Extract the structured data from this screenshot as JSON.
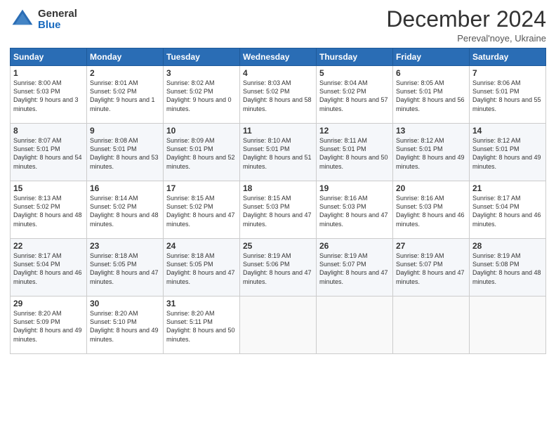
{
  "logo": {
    "general": "General",
    "blue": "Blue"
  },
  "header": {
    "month": "December 2024",
    "location": "Pereval'noye, Ukraine"
  },
  "weekdays": [
    "Sunday",
    "Monday",
    "Tuesday",
    "Wednesday",
    "Thursday",
    "Friday",
    "Saturday"
  ],
  "weeks": [
    [
      {
        "day": "1",
        "sunrise": "8:00 AM",
        "sunset": "5:03 PM",
        "daylight": "9 hours and 3 minutes."
      },
      {
        "day": "2",
        "sunrise": "8:01 AM",
        "sunset": "5:02 PM",
        "daylight": "9 hours and 1 minute."
      },
      {
        "day": "3",
        "sunrise": "8:02 AM",
        "sunset": "5:02 PM",
        "daylight": "9 hours and 0 minutes."
      },
      {
        "day": "4",
        "sunrise": "8:03 AM",
        "sunset": "5:02 PM",
        "daylight": "8 hours and 58 minutes."
      },
      {
        "day": "5",
        "sunrise": "8:04 AM",
        "sunset": "5:02 PM",
        "daylight": "8 hours and 57 minutes."
      },
      {
        "day": "6",
        "sunrise": "8:05 AM",
        "sunset": "5:01 PM",
        "daylight": "8 hours and 56 minutes."
      },
      {
        "day": "7",
        "sunrise": "8:06 AM",
        "sunset": "5:01 PM",
        "daylight": "8 hours and 55 minutes."
      }
    ],
    [
      {
        "day": "8",
        "sunrise": "8:07 AM",
        "sunset": "5:01 PM",
        "daylight": "8 hours and 54 minutes."
      },
      {
        "day": "9",
        "sunrise": "8:08 AM",
        "sunset": "5:01 PM",
        "daylight": "8 hours and 53 minutes."
      },
      {
        "day": "10",
        "sunrise": "8:09 AM",
        "sunset": "5:01 PM",
        "daylight": "8 hours and 52 minutes."
      },
      {
        "day": "11",
        "sunrise": "8:10 AM",
        "sunset": "5:01 PM",
        "daylight": "8 hours and 51 minutes."
      },
      {
        "day": "12",
        "sunrise": "8:11 AM",
        "sunset": "5:01 PM",
        "daylight": "8 hours and 50 minutes."
      },
      {
        "day": "13",
        "sunrise": "8:12 AM",
        "sunset": "5:01 PM",
        "daylight": "8 hours and 49 minutes."
      },
      {
        "day": "14",
        "sunrise": "8:12 AM",
        "sunset": "5:01 PM",
        "daylight": "8 hours and 49 minutes."
      }
    ],
    [
      {
        "day": "15",
        "sunrise": "8:13 AM",
        "sunset": "5:02 PM",
        "daylight": "8 hours and 48 minutes."
      },
      {
        "day": "16",
        "sunrise": "8:14 AM",
        "sunset": "5:02 PM",
        "daylight": "8 hours and 48 minutes."
      },
      {
        "day": "17",
        "sunrise": "8:15 AM",
        "sunset": "5:02 PM",
        "daylight": "8 hours and 47 minutes."
      },
      {
        "day": "18",
        "sunrise": "8:15 AM",
        "sunset": "5:03 PM",
        "daylight": "8 hours and 47 minutes."
      },
      {
        "day": "19",
        "sunrise": "8:16 AM",
        "sunset": "5:03 PM",
        "daylight": "8 hours and 47 minutes."
      },
      {
        "day": "20",
        "sunrise": "8:16 AM",
        "sunset": "5:03 PM",
        "daylight": "8 hours and 46 minutes."
      },
      {
        "day": "21",
        "sunrise": "8:17 AM",
        "sunset": "5:04 PM",
        "daylight": "8 hours and 46 minutes."
      }
    ],
    [
      {
        "day": "22",
        "sunrise": "8:17 AM",
        "sunset": "5:04 PM",
        "daylight": "8 hours and 46 minutes."
      },
      {
        "day": "23",
        "sunrise": "8:18 AM",
        "sunset": "5:05 PM",
        "daylight": "8 hours and 47 minutes."
      },
      {
        "day": "24",
        "sunrise": "8:18 AM",
        "sunset": "5:05 PM",
        "daylight": "8 hours and 47 minutes."
      },
      {
        "day": "25",
        "sunrise": "8:19 AM",
        "sunset": "5:06 PM",
        "daylight": "8 hours and 47 minutes."
      },
      {
        "day": "26",
        "sunrise": "8:19 AM",
        "sunset": "5:07 PM",
        "daylight": "8 hours and 47 minutes."
      },
      {
        "day": "27",
        "sunrise": "8:19 AM",
        "sunset": "5:07 PM",
        "daylight": "8 hours and 47 minutes."
      },
      {
        "day": "28",
        "sunrise": "8:19 AM",
        "sunset": "5:08 PM",
        "daylight": "8 hours and 48 minutes."
      }
    ],
    [
      {
        "day": "29",
        "sunrise": "8:20 AM",
        "sunset": "5:09 PM",
        "daylight": "8 hours and 49 minutes."
      },
      {
        "day": "30",
        "sunrise": "8:20 AM",
        "sunset": "5:10 PM",
        "daylight": "8 hours and 49 minutes."
      },
      {
        "day": "31",
        "sunrise": "8:20 AM",
        "sunset": "5:11 PM",
        "daylight": "8 hours and 50 minutes."
      },
      null,
      null,
      null,
      null
    ]
  ]
}
